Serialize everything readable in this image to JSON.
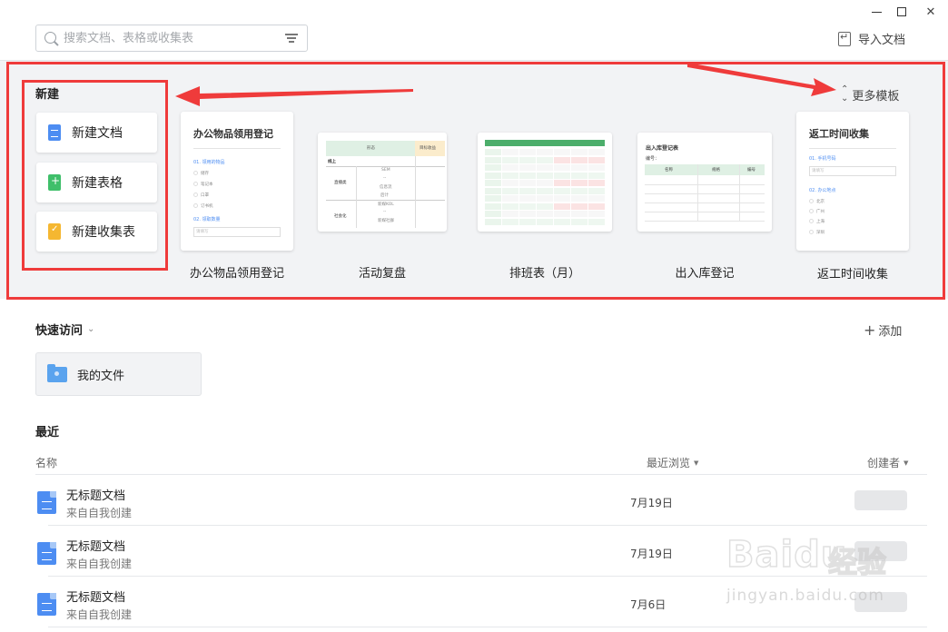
{
  "search": {
    "placeholder": "搜索文档、表格或收集表"
  },
  "header": {
    "import_label": "导入文档"
  },
  "create": {
    "title": "新建",
    "items": [
      {
        "label": "新建文档",
        "icon": "doc-icon"
      },
      {
        "label": "新建表格",
        "icon": "sheet-icon"
      },
      {
        "label": "新建收集表",
        "icon": "form-icon"
      }
    ]
  },
  "templates": {
    "more_label": "更多模板",
    "items": [
      {
        "name": "办公物品领用登记"
      },
      {
        "name": "活动复盘"
      },
      {
        "name": "排班表（月）"
      },
      {
        "name": "出入库登记"
      },
      {
        "name": "返工时间收集"
      }
    ],
    "thumbs": {
      "office": {
        "title": "办公物品领用登记",
        "q1": "01. 领用的物品",
        "opts": [
          "储存",
          "笔记本",
          "口罩",
          "订书机"
        ],
        "q2": "02. 领取数量",
        "input": "请填写"
      },
      "review": {
        "h1": "形态",
        "h2": "目标收益",
        "r1": "线上",
        "r2": "直播类",
        "r3": "社会化",
        "c": [
          "SEM",
          "--",
          "信息流",
          "后计",
          "新媒KOL",
          "--",
          "新媒社群"
        ]
      },
      "inout": {
        "title": "出入库登记表",
        "label": "编号：",
        "cols": [
          "名称",
          "规格",
          "编号"
        ]
      },
      "returnwork": {
        "title": "返工时间收集",
        "q1": "01. 手机号码",
        "input": "请填写",
        "q2": "02. 办公地点",
        "opts": [
          "北京",
          "广州",
          "上海",
          "深圳"
        ]
      }
    }
  },
  "quick_access": {
    "title": "快速访问",
    "add_label": "添加",
    "items": [
      {
        "label": "我的文件"
      }
    ]
  },
  "recent": {
    "title": "最近",
    "columns": {
      "name": "名称",
      "browsed": "最近浏览",
      "creator": "创建者"
    },
    "rows": [
      {
        "name": "无标题文档",
        "source": "来自自我创建",
        "date": "7月19日"
      },
      {
        "name": "无标题文档",
        "source": "来自自我创建",
        "date": "7月19日"
      },
      {
        "name": "无标题文档",
        "source": "来自自我创建",
        "date": "7月6日"
      }
    ]
  },
  "watermark": {
    "brand": "Baidu",
    "brand_cn": "经验",
    "url": "jingyan.baidu.com"
  },
  "colors": {
    "annotation_red": "#ef3b3b",
    "doc_blue": "#4d8df2",
    "sheet_green": "#3fbf6a",
    "form_yellow": "#f5b731",
    "section_bg": "#f2f3f5"
  }
}
